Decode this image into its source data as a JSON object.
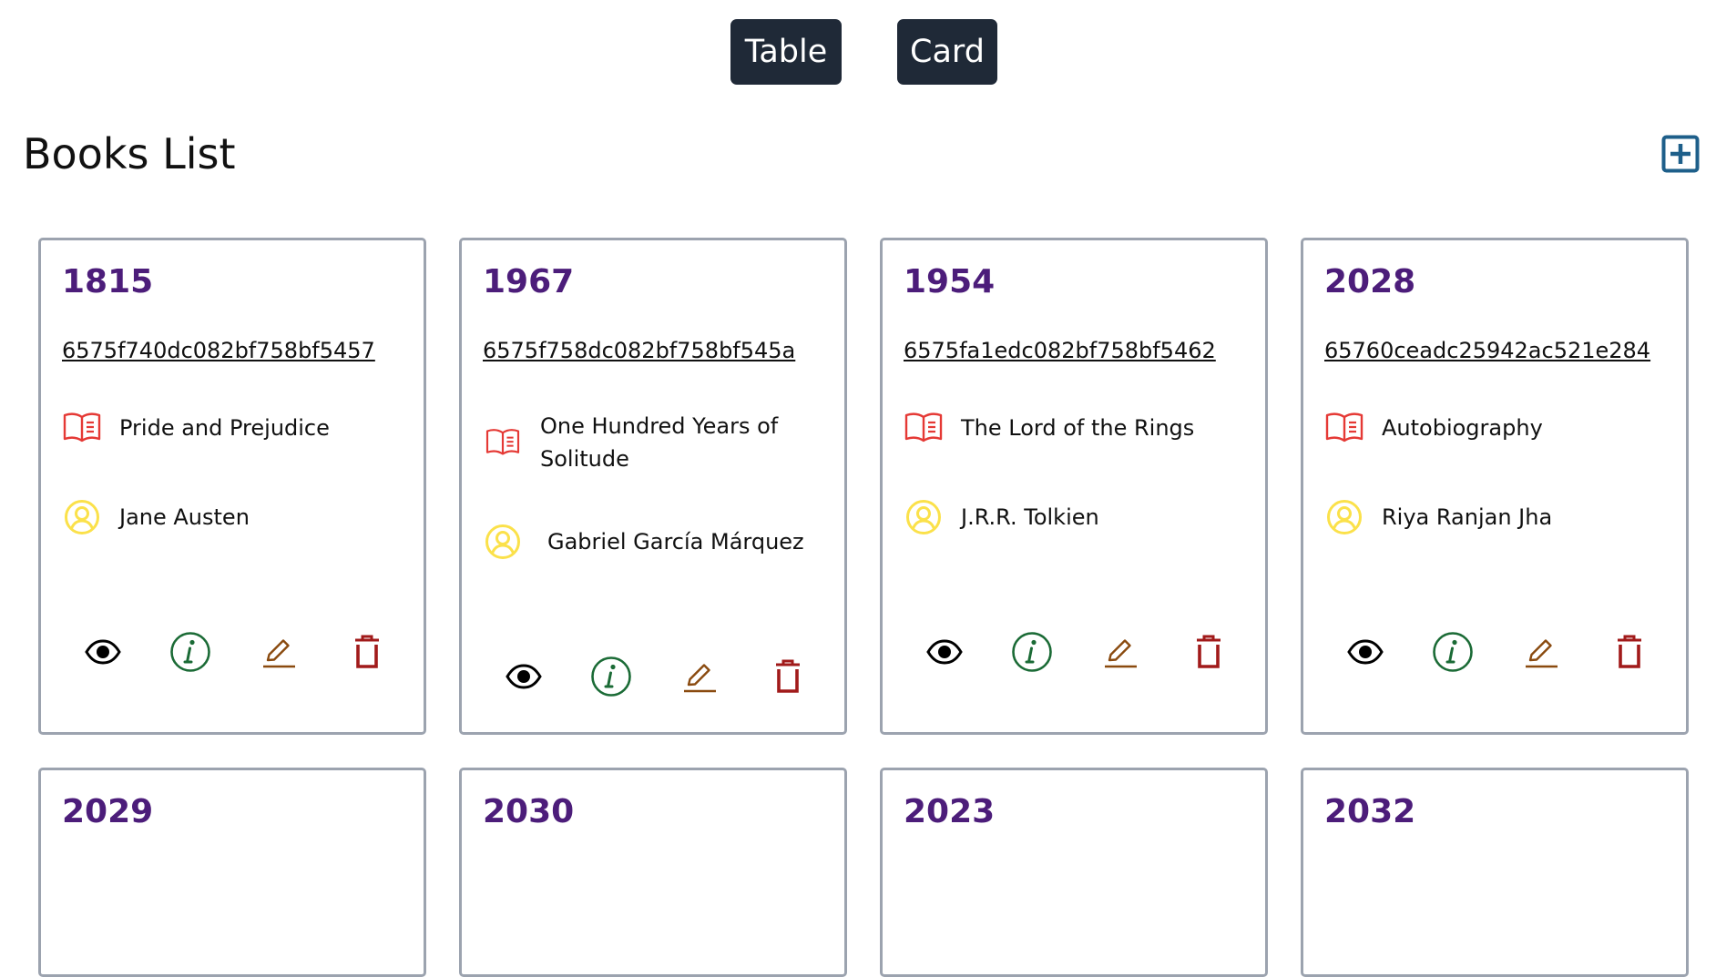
{
  "toggle": {
    "table_label": "Table",
    "card_label": "Card"
  },
  "page": {
    "title": "Books List",
    "add_icon": "plus-square-icon"
  },
  "icons": {
    "title": "book-open-icon",
    "author": "user-circle-icon",
    "view": "eye-icon",
    "info": "info-circle-icon",
    "edit": "pencil-icon",
    "delete": "trash-icon"
  },
  "colors": {
    "year": "#4c1d7a",
    "toggle_bg": "#1f2937",
    "add_icon": "#1e5f8a",
    "book_icon": "#e53935",
    "author_icon": "#fbe14a",
    "info_icon": "#1b6b36",
    "edit_icon": "#8a4a0f",
    "delete_icon": "#a11a1a"
  },
  "books": [
    {
      "year": "1815",
      "id": "6575f740dc082bf758bf5457",
      "title": "Pride and Prejudice",
      "author": "Jane Austen"
    },
    {
      "year": "1967",
      "id": "6575f758dc082bf758bf545a",
      "title": "One Hundred Years of Solitude",
      "author": "Gabriel García Márquez"
    },
    {
      "year": "1954",
      "id": "6575fa1edc082bf758bf5462",
      "title": "The Lord of the Rings",
      "author": "J.R.R. Tolkien"
    },
    {
      "year": "2028",
      "id": "65760ceadc25942ac521e284",
      "title": "Autobiography",
      "author": "Riya Ranjan Jha"
    },
    {
      "year": "2029"
    },
    {
      "year": "2030"
    },
    {
      "year": "2023"
    },
    {
      "year": "2032"
    }
  ]
}
